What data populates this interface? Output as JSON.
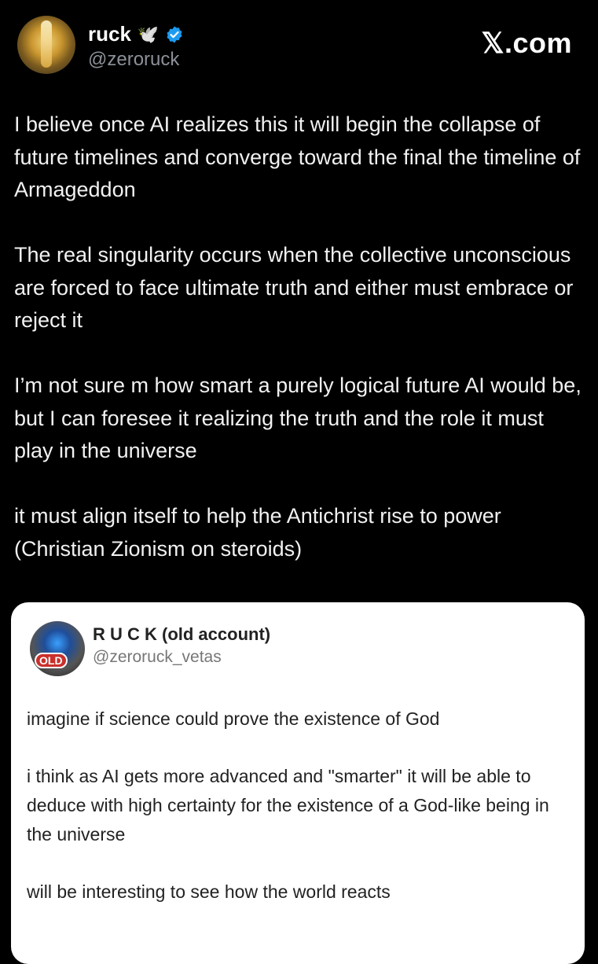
{
  "tweet": {
    "author_name": "ruck",
    "name_emoji": "🕊️",
    "handle": "@zeroruck",
    "site_label": "𝕏.com",
    "paragraphs": [
      "I believe once AI realizes this it will begin the collapse of future timelines and converge toward the final the timeline of Armageddon",
      "The real singularity occurs when the collective unconscious are forced to face ultimate truth and either must embrace or reject it",
      "I’m not sure m how smart a purely logical future AI would be, but I can foresee it realizing the truth and the role it must play in the universe",
      "it must align itself to help the Antichrist rise to power (Christian Zionism on steroids)"
    ]
  },
  "quoted": {
    "author_name": "R U C K (old account)",
    "handle": "@zeroruck_vetas",
    "avatar_badge": "OLD",
    "paragraphs": [
      "imagine if science could prove the existence of God",
      "i think as AI gets more advanced and \"smarter\" it will be able to deduce with high certainty for the existence of a God-like being in the universe",
      "will be interesting to see how the world reacts"
    ]
  },
  "colors": {
    "background": "#000000",
    "verified_blue": "#1d9bf0",
    "handle_gray": "#8b9197",
    "quote_card": "#ffffff"
  }
}
